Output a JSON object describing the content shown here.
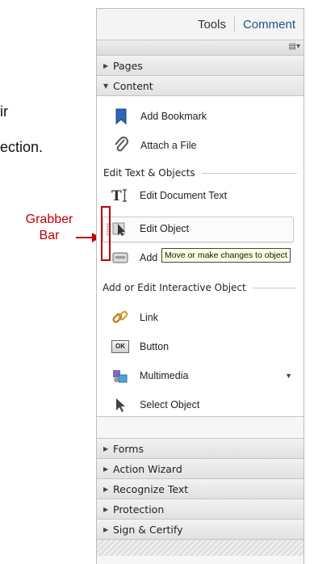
{
  "background_fragments": [
    "ir",
    "ection."
  ],
  "callout": {
    "line1": "Grabber",
    "line2": "Bar"
  },
  "tabs": {
    "tools": "Tools",
    "comment": "Comment"
  },
  "sections": {
    "pages": "Pages",
    "content": "Content",
    "forms": "Forms",
    "action_wizard": "Action Wizard",
    "recognize_text": "Recognize Text",
    "protection": "Protection",
    "sign_certify": "Sign & Certify"
  },
  "content": {
    "add_bookmark": "Add Bookmark",
    "attach_file": "Attach a File",
    "edit_text_objects_header": "Edit Text & Objects",
    "edit_document_text": "Edit Document Text",
    "edit_object": "Edit Object",
    "add_partial": "Add",
    "tooltip": "Move or make changes to object",
    "interactive_header": "Add or Edit Interactive Object",
    "link": "Link",
    "button": "Button",
    "button_icon_text": "OK",
    "multimedia": "Multimedia",
    "select_object": "Select Object"
  },
  "colors": {
    "accent_red": "#c00000",
    "comment_blue": "#1f4f8f",
    "tooltip_bg": "#ffffe1"
  }
}
